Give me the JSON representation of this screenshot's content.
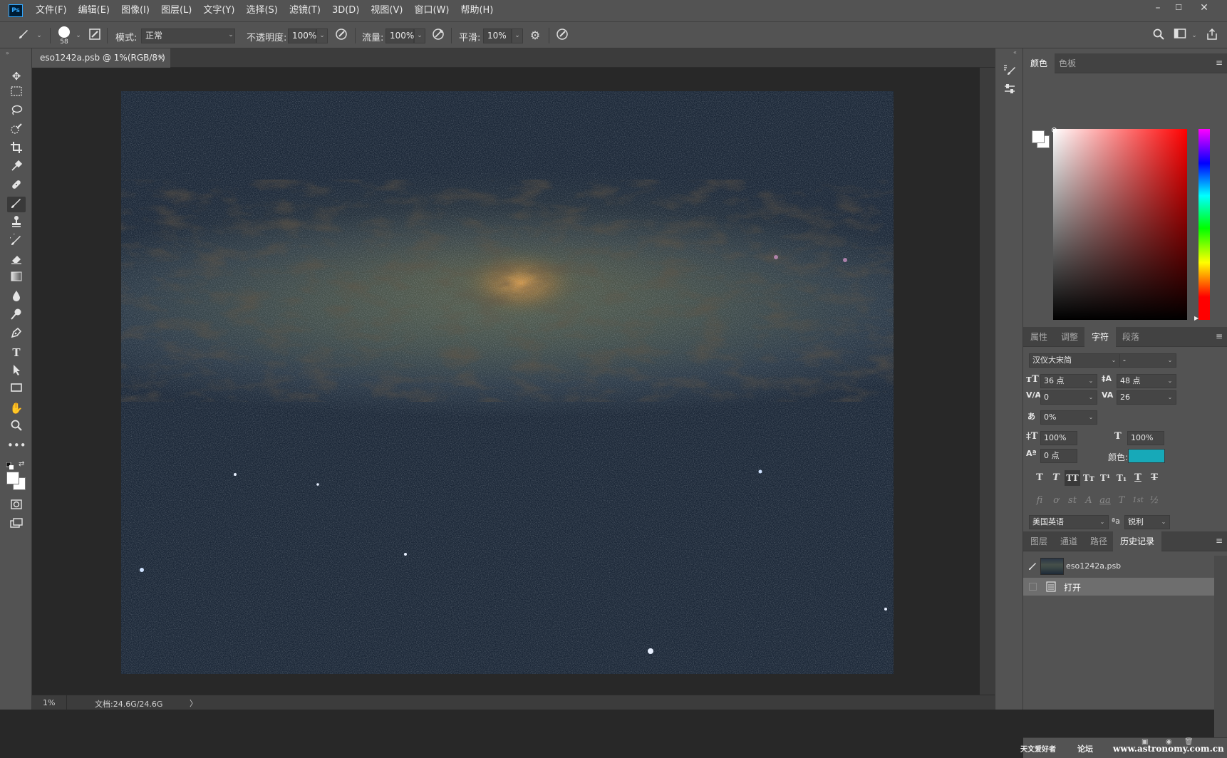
{
  "app": {
    "logo": "Ps"
  },
  "menu": [
    "文件(F)",
    "编辑(E)",
    "图像(I)",
    "图层(L)",
    "文字(Y)",
    "选择(S)",
    "滤镜(T)",
    "3D(D)",
    "视图(V)",
    "窗口(W)",
    "帮助(H)"
  ],
  "window_controls": {
    "minimize": "–",
    "maximize": "☐",
    "close": "✕"
  },
  "options": {
    "brush_size": "58",
    "mode_label": "模式:",
    "mode_value": "正常",
    "opacity_label": "不透明度:",
    "opacity_value": "100%",
    "flow_label": "流量:",
    "flow_value": "100%",
    "smooth_label": "平滑:",
    "smooth_value": "10%"
  },
  "document": {
    "tab_title": "eso1242a.psb @ 1%(RGB/8*)",
    "tab_close": "×",
    "zoom": "1%",
    "doc_info": "文档:24.6G/24.6G",
    "status_arrow": "〉"
  },
  "color_panel": {
    "tabs": [
      "颜色",
      "色板"
    ],
    "active": 0
  },
  "char_panel": {
    "tabs": [
      "属性",
      "调整",
      "字符",
      "段落"
    ],
    "active": 2,
    "font_family": "汉仪大宋简",
    "font_style": "-",
    "font_size": "36 点",
    "leading": "48 点",
    "kerning": "0",
    "tracking": "26",
    "tsume": "0%",
    "vertical_scale": "100%",
    "horizontal_scale": "100%",
    "baseline_shift": "0 点",
    "color_label": "颜色:",
    "color_value": "#17a9b8",
    "type_buttons": [
      "T",
      "T",
      "TT",
      "Tт",
      "T¹",
      "T₁",
      "T",
      "T"
    ],
    "opentype_buttons": [
      "fi",
      "ơ",
      "st",
      "A",
      "aa",
      "T",
      "1st",
      "½"
    ],
    "language": "美国英语",
    "aa_icon": "ªa",
    "antialias": "锐利"
  },
  "history_panel": {
    "tabs": [
      "图层",
      "通道",
      "路径",
      "历史记录"
    ],
    "active": 3,
    "snapshot_name": "eso1242a.psb",
    "steps": [
      "打开"
    ]
  },
  "watermark": {
    "left": "天文爱好者",
    "middle": "论坛",
    "right": "www.astronomy.com.cn"
  },
  "colors": {
    "foreground": "#ffffff",
    "background": "#ffffff",
    "accent": "#17a9b8"
  }
}
